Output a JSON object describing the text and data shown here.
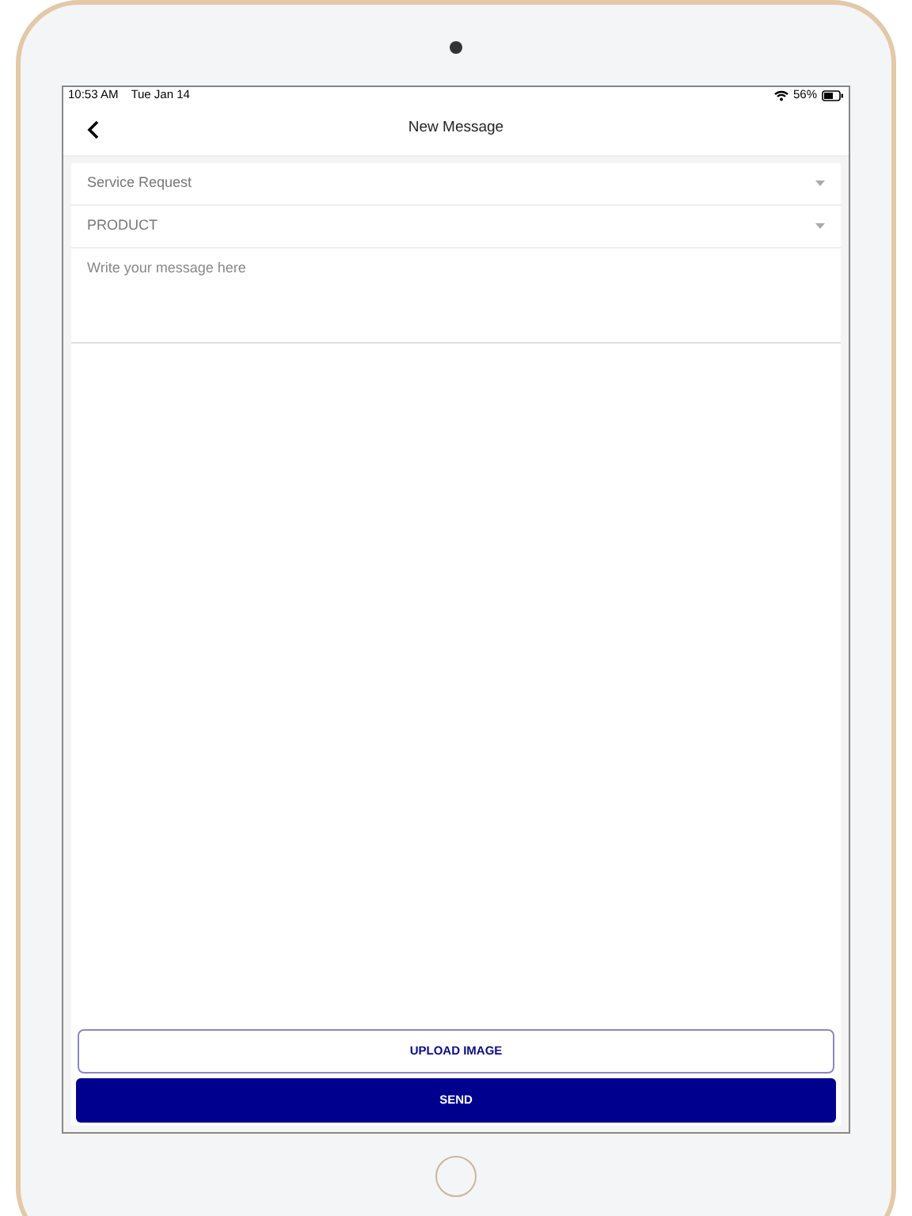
{
  "status_bar": {
    "time": "10:53 AM",
    "date": "Tue Jan 14",
    "battery": "56%"
  },
  "header": {
    "title": "New Message"
  },
  "dropdowns": [
    {
      "placeholder": "Service Request"
    },
    {
      "placeholder": "PRODUCT"
    }
  ],
  "message": {
    "placeholder": "Write your message here"
  },
  "buttons": [
    {
      "label": "UPLOAD IMAGE",
      "kind": "outline"
    },
    {
      "label": "SEND",
      "kind": "filled"
    }
  ]
}
